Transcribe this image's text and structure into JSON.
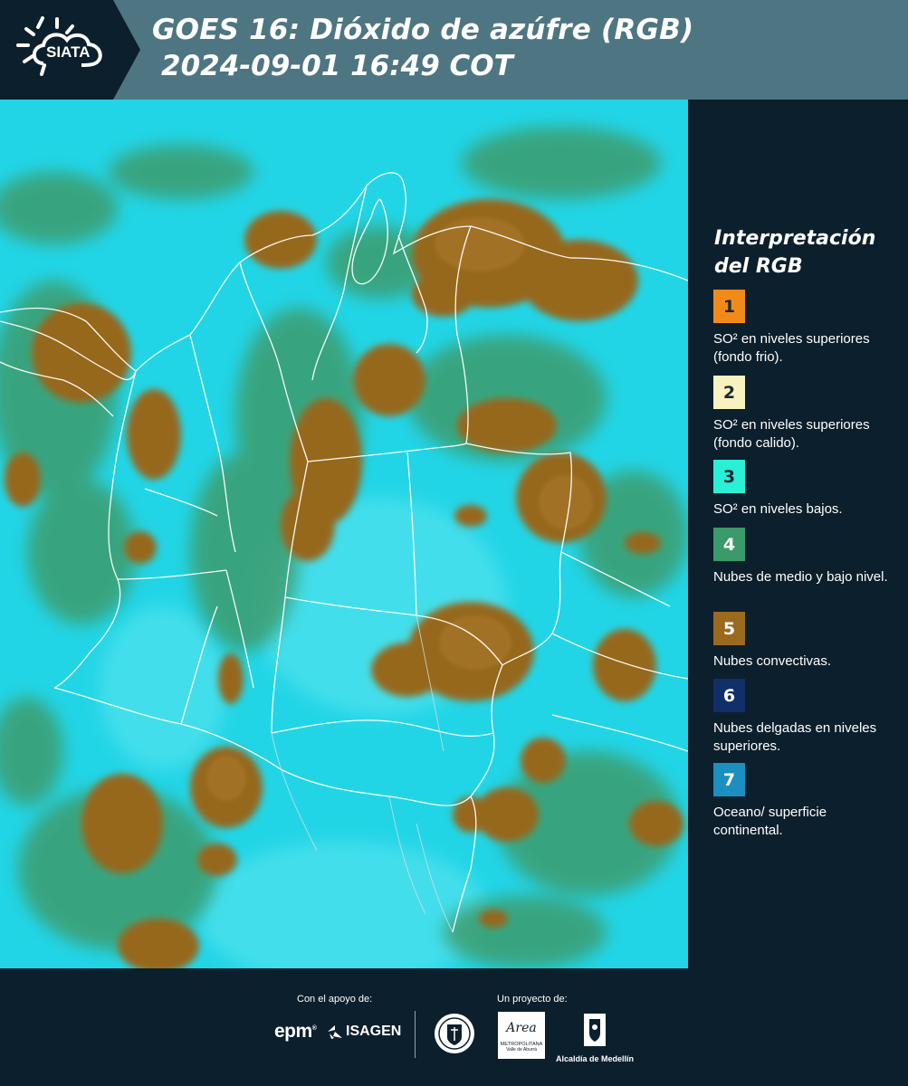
{
  "header": {
    "logo_text": "SIATA",
    "title": "GOES 16: Dióxido de azúfre (RGB)",
    "subtitle": "2024-09-01 16:49 COT"
  },
  "legend": {
    "title_line1": "Interpretación",
    "title_line2": "del RGB",
    "items": [
      {
        "number": "1",
        "color": "#f28a1a",
        "text": "SO² en niveles superiores (fondo frio)."
      },
      {
        "number": "2",
        "color": "#f8f2c0",
        "text": "SO² en niveles superiores (fondo calido)."
      },
      {
        "number": "3",
        "color": "#2af0d6",
        "text": "SO² en niveles bajos."
      },
      {
        "number": "4",
        "color": "#3a9a6a",
        "text": "Nubes de medio y bajo nivel."
      },
      {
        "number": "5",
        "color": "#9a6a1e",
        "text": "Nubes convectivas."
      },
      {
        "number": "6",
        "color": "#11306a",
        "text": "Nubes delgadas en niveles superiores."
      },
      {
        "number": "7",
        "color": "#1a8fc0",
        "text": "Oceano/ superficie continental."
      }
    ]
  },
  "footer": {
    "support_label": "Con el apoyo de:",
    "project_label": "Un proyecto de:",
    "brand_epm": "epm",
    "brand_isagen": "ISAGEN",
    "brand_area_line1": "Area",
    "brand_area_line2": "METROPOLITANA",
    "brand_area_line3": "Valle de Aburrá",
    "brand_alcaldia": "Alcaldía de Medellín"
  },
  "colors": {
    "background": "#0c1f2c",
    "header": "#4e7582",
    "surface_cyan": "#1fd6e6",
    "convective_brown": "#9a6a1e",
    "low_cloud_green": "#3a9a6a",
    "boundary_white": "#ffffff"
  }
}
